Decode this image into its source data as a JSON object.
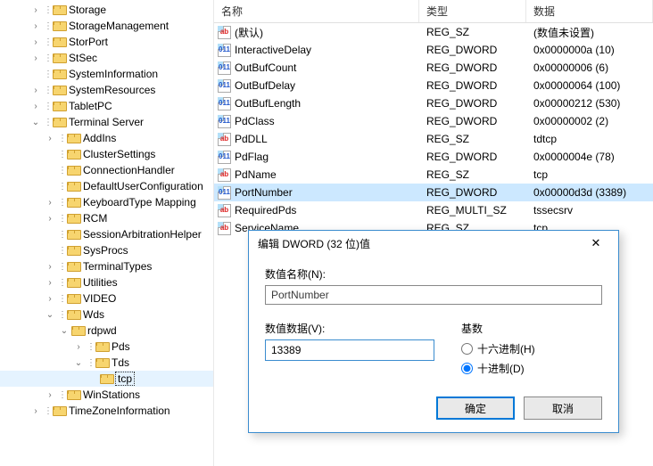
{
  "tree": {
    "items": [
      {
        "label": "Storage",
        "depth": 2,
        "exp": ">",
        "dots": true
      },
      {
        "label": "StorageManagement",
        "depth": 2,
        "exp": ">",
        "dots": true
      },
      {
        "label": "StorPort",
        "depth": 2,
        "exp": ">",
        "dots": true
      },
      {
        "label": "StSec",
        "depth": 2,
        "exp": ">",
        "dots": true
      },
      {
        "label": "SystemInformation",
        "depth": 2,
        "exp": "",
        "dots": true
      },
      {
        "label": "SystemResources",
        "depth": 2,
        "exp": ">",
        "dots": true
      },
      {
        "label": "TabletPC",
        "depth": 2,
        "exp": ">",
        "dots": true
      },
      {
        "label": "Terminal Server",
        "depth": 2,
        "exp": "v",
        "dots": true
      },
      {
        "label": "AddIns",
        "depth": 3,
        "exp": ">",
        "dots": true
      },
      {
        "label": "ClusterSettings",
        "depth": 3,
        "exp": "",
        "dots": true
      },
      {
        "label": "ConnectionHandler",
        "depth": 3,
        "exp": "",
        "dots": true
      },
      {
        "label": "DefaultUserConfiguration",
        "depth": 3,
        "exp": "",
        "dots": true
      },
      {
        "label": "KeyboardType Mapping",
        "depth": 3,
        "exp": ">",
        "dots": true
      },
      {
        "label": "RCM",
        "depth": 3,
        "exp": ">",
        "dots": true
      },
      {
        "label": "SessionArbitrationHelper",
        "depth": 3,
        "exp": "",
        "dots": true
      },
      {
        "label": "SysProcs",
        "depth": 3,
        "exp": "",
        "dots": true
      },
      {
        "label": "TerminalTypes",
        "depth": 3,
        "exp": ">",
        "dots": true
      },
      {
        "label": "Utilities",
        "depth": 3,
        "exp": ">",
        "dots": true
      },
      {
        "label": "VIDEO",
        "depth": 3,
        "exp": ">",
        "dots": true
      },
      {
        "label": "Wds",
        "depth": 3,
        "exp": "v",
        "dots": true
      },
      {
        "label": "rdpwd",
        "depth": 4,
        "exp": "v",
        "dots": false
      },
      {
        "label": "Pds",
        "depth": 5,
        "exp": ">",
        "dots": true
      },
      {
        "label": "Tds",
        "depth": 5,
        "exp": "v",
        "dots": true
      },
      {
        "label": "tcp",
        "depth": 6,
        "exp": "",
        "dots": false,
        "selected": true
      },
      {
        "label": "WinStations",
        "depth": 3,
        "exp": ">",
        "dots": true
      },
      {
        "label": "TimeZoneInformation",
        "depth": 2,
        "exp": ">",
        "dots": true
      }
    ]
  },
  "columns": {
    "name": "名称",
    "type": "类型",
    "data": "数据"
  },
  "rows": [
    {
      "icon": "sz",
      "name": "(默认)",
      "type": "REG_SZ",
      "data": "(数值未设置)"
    },
    {
      "icon": "bin",
      "name": "InteractiveDelay",
      "type": "REG_DWORD",
      "data": "0x0000000a (10)"
    },
    {
      "icon": "bin",
      "name": "OutBufCount",
      "type": "REG_DWORD",
      "data": "0x00000006 (6)"
    },
    {
      "icon": "bin",
      "name": "OutBufDelay",
      "type": "REG_DWORD",
      "data": "0x00000064 (100)"
    },
    {
      "icon": "bin",
      "name": "OutBufLength",
      "type": "REG_DWORD",
      "data": "0x00000212 (530)"
    },
    {
      "icon": "bin",
      "name": "PdClass",
      "type": "REG_DWORD",
      "data": "0x00000002 (2)"
    },
    {
      "icon": "sz",
      "name": "PdDLL",
      "type": "REG_SZ",
      "data": "tdtcp"
    },
    {
      "icon": "bin",
      "name": "PdFlag",
      "type": "REG_DWORD",
      "data": "0x0000004e (78)"
    },
    {
      "icon": "sz",
      "name": "PdName",
      "type": "REG_SZ",
      "data": "tcp"
    },
    {
      "icon": "bin",
      "name": "PortNumber",
      "type": "REG_DWORD",
      "data": "0x00000d3d (3389)",
      "selected": true
    },
    {
      "icon": "sz",
      "name": "RequiredPds",
      "type": "REG_MULTI_SZ",
      "data": "tssecsrv"
    },
    {
      "icon": "sz",
      "name": "ServiceName",
      "type": "REG_SZ",
      "data": "tcp"
    }
  ],
  "dialog": {
    "title": "编辑 DWORD (32 位)值",
    "close": "✕",
    "name_label": "数值名称(N):",
    "name_value": "PortNumber",
    "data_label": "数值数据(V):",
    "data_value": "13389",
    "base_label": "基数",
    "radio_hex": "十六进制(H)",
    "radio_dec": "十进制(D)",
    "ok": "确定",
    "cancel": "取消"
  }
}
